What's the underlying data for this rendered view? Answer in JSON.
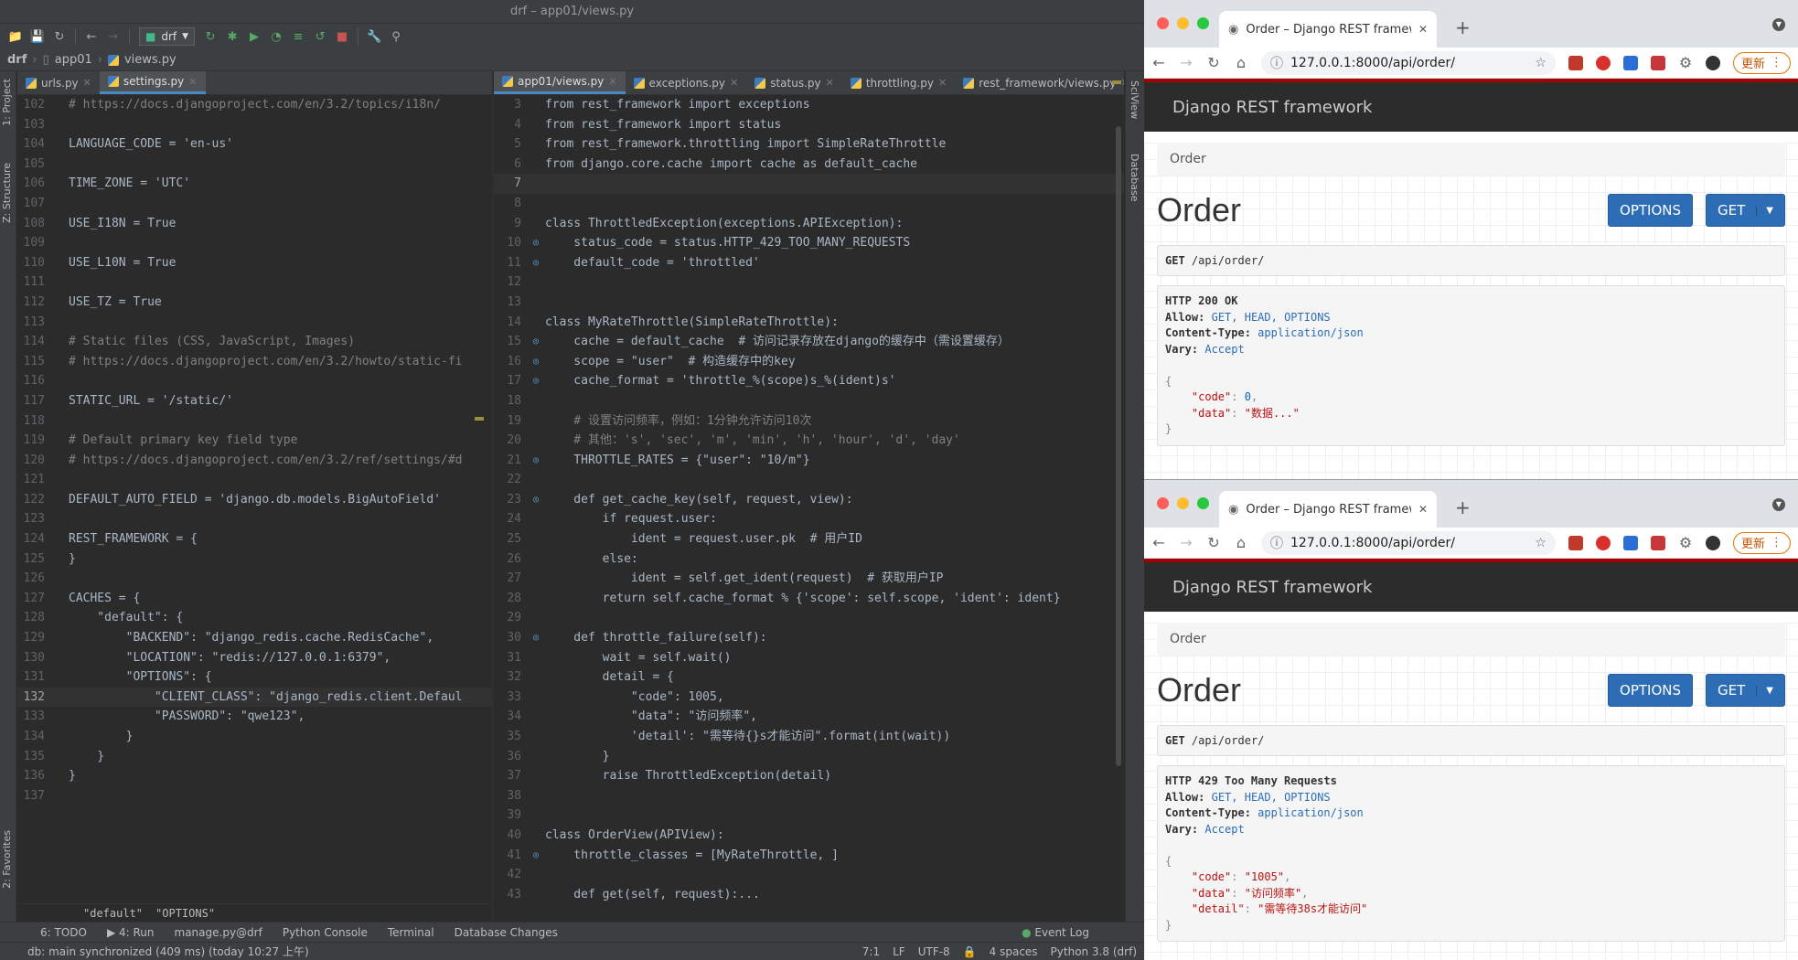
{
  "ide": {
    "window_title": "drf – app01/views.py",
    "run_config": "drf",
    "breadcrumb": [
      "drf",
      "app01",
      "views.py"
    ],
    "left_tool_windows": [
      "1: Project",
      "Z: Structure",
      "2: Favorites"
    ],
    "right_tool_windows": [
      "SciView",
      "Database"
    ],
    "left_tabs": [
      {
        "label": "urls.py",
        "active": false
      },
      {
        "label": "settings.py",
        "active": true
      }
    ],
    "right_tabs": [
      {
        "label": "app01/views.py",
        "active": true
      },
      {
        "label": "exceptions.py",
        "active": false
      },
      {
        "label": "status.py",
        "active": false
      },
      {
        "label": "throttling.py",
        "active": false
      },
      {
        "label": "rest_framework/views.py",
        "active": false
      }
    ],
    "left_code_breadcrumb": [
      "\"default\"",
      "\"OPTIONS\""
    ],
    "bottom_tools": [
      "6: TODO",
      "4: Run",
      "manage.py@drf",
      "Python Console",
      "Terminal",
      "Database Changes",
      "Event Log"
    ],
    "status_message": "db: main synchronized (409 ms) (today 10:27 上午)",
    "status_right": [
      "7:1",
      "LF",
      "UTF-8",
      "4 spaces",
      "Python 3.8 (drf)"
    ]
  },
  "left_code": [
    {
      "n": "102",
      "t": "# https://docs.djangoproject.com/en/3.2/topics/i18n/"
    },
    {
      "n": "103",
      "t": ""
    },
    {
      "n": "104",
      "t": "LANGUAGE_CODE = 'en-us'"
    },
    {
      "n": "105",
      "t": ""
    },
    {
      "n": "106",
      "t": "TIME_ZONE = 'UTC'"
    },
    {
      "n": "107",
      "t": ""
    },
    {
      "n": "108",
      "t": "USE_I18N = True"
    },
    {
      "n": "109",
      "t": ""
    },
    {
      "n": "110",
      "t": "USE_L10N = True"
    },
    {
      "n": "111",
      "t": ""
    },
    {
      "n": "112",
      "t": "USE_TZ = True"
    },
    {
      "n": "113",
      "t": ""
    },
    {
      "n": "114",
      "t": "# Static files (CSS, JavaScript, Images)"
    },
    {
      "n": "115",
      "t": "# https://docs.djangoproject.com/en/3.2/howto/static-fi"
    },
    {
      "n": "116",
      "t": ""
    },
    {
      "n": "117",
      "t": "STATIC_URL = '/static/'"
    },
    {
      "n": "118",
      "t": ""
    },
    {
      "n": "119",
      "t": "# Default primary key field type"
    },
    {
      "n": "120",
      "t": "# https://docs.djangoproject.com/en/3.2/ref/settings/#d"
    },
    {
      "n": "121",
      "t": ""
    },
    {
      "n": "122",
      "t": "DEFAULT_AUTO_FIELD = 'django.db.models.BigAutoField'"
    },
    {
      "n": "123",
      "t": ""
    },
    {
      "n": "124",
      "t": "REST_FRAMEWORK = {"
    },
    {
      "n": "125",
      "t": "}"
    },
    {
      "n": "126",
      "t": ""
    },
    {
      "n": "127",
      "t": "CACHES = {"
    },
    {
      "n": "128",
      "t": "    \"default\": {"
    },
    {
      "n": "129",
      "t": "        \"BACKEND\": \"django_redis.cache.RedisCache\","
    },
    {
      "n": "130",
      "t": "        \"LOCATION\": \"redis://127.0.0.1:6379\","
    },
    {
      "n": "131",
      "t": "        \"OPTIONS\": {"
    },
    {
      "n": "132",
      "t": "            \"CLIENT_CLASS\": \"django_redis.client.Defaul"
    },
    {
      "n": "133",
      "t": "            \"PASSWORD\": \"qwe123\","
    },
    {
      "n": "134",
      "t": "        }"
    },
    {
      "n": "135",
      "t": "    }"
    },
    {
      "n": "136",
      "t": "}"
    },
    {
      "n": "137",
      "t": ""
    }
  ],
  "right_code": [
    {
      "n": "3",
      "t": "from rest_framework import exceptions"
    },
    {
      "n": "4",
      "t": "from rest_framework import status"
    },
    {
      "n": "5",
      "t": "from rest_framework.throttling import SimpleRateThrottle"
    },
    {
      "n": "6",
      "t": "from django.core.cache import cache as default_cache"
    },
    {
      "n": "7",
      "t": ""
    },
    {
      "n": "8",
      "t": ""
    },
    {
      "n": "9",
      "t": "class ThrottledException(exceptions.APIException):"
    },
    {
      "n": "10",
      "t": "    status_code = status.HTTP_429_TOO_MANY_REQUESTS"
    },
    {
      "n": "11",
      "t": "    default_code = 'throttled'"
    },
    {
      "n": "12",
      "t": ""
    },
    {
      "n": "13",
      "t": ""
    },
    {
      "n": "14",
      "t": "class MyRateThrottle(SimpleRateThrottle):"
    },
    {
      "n": "15",
      "t": "    cache = default_cache  # 访问记录存放在django的缓存中（需设置缓存）"
    },
    {
      "n": "16",
      "t": "    scope = \"user\"  # 构造缓存中的key"
    },
    {
      "n": "17",
      "t": "    cache_format = 'throttle_%(scope)s_%(ident)s'"
    },
    {
      "n": "18",
      "t": ""
    },
    {
      "n": "19",
      "t": "    # 设置访问频率，例如：1分钟允许访问10次"
    },
    {
      "n": "20",
      "t": "    # 其他：'s', 'sec', 'm', 'min', 'h', 'hour', 'd', 'day'"
    },
    {
      "n": "21",
      "t": "    THROTTLE_RATES = {\"user\": \"10/m\"}"
    },
    {
      "n": "22",
      "t": ""
    },
    {
      "n": "23",
      "t": "    def get_cache_key(self, request, view):"
    },
    {
      "n": "24",
      "t": "        if request.user:"
    },
    {
      "n": "25",
      "t": "            ident = request.user.pk  # 用户ID"
    },
    {
      "n": "26",
      "t": "        else:"
    },
    {
      "n": "27",
      "t": "            ident = self.get_ident(request)  # 获取用户IP"
    },
    {
      "n": "28",
      "t": "        return self.cache_format % {'scope': self.scope, 'ident': ident}"
    },
    {
      "n": "29",
      "t": ""
    },
    {
      "n": "30",
      "t": "    def throttle_failure(self):"
    },
    {
      "n": "31",
      "t": "        wait = self.wait()"
    },
    {
      "n": "32",
      "t": "        detail = {"
    },
    {
      "n": "33",
      "t": "            \"code\": 1005,"
    },
    {
      "n": "34",
      "t": "            \"data\": \"访问频率\","
    },
    {
      "n": "35",
      "t": "            'detail': \"需等待{}s才能访问\".format(int(wait))"
    },
    {
      "n": "36",
      "t": "        }"
    },
    {
      "n": "37",
      "t": "        raise ThrottledException(detail)"
    },
    {
      "n": "38",
      "t": ""
    },
    {
      "n": "39",
      "t": ""
    },
    {
      "n": "40",
      "t": "class OrderView(APIView):"
    },
    {
      "n": "41",
      "t": "    throttle_classes = [MyRateThrottle, ]"
    },
    {
      "n": "42",
      "t": ""
    },
    {
      "n": "43",
      "t": "    def get(self, request):..."
    }
  ],
  "browser_top": {
    "tab_title": "Order – Django REST framework",
    "url": "127.0.0.1:8000/api/order/",
    "update_label": "更新",
    "navbar_brand": "Django REST framework",
    "breadcrumb": "Order",
    "page_title": "Order",
    "options_label": "OPTIONS",
    "get_label": "GET",
    "request_method": "GET",
    "request_path": "/api/order/",
    "status_line": "HTTP 200 OK",
    "headers": [
      {
        "k": "Allow:",
        "v": "GET, HEAD, OPTIONS"
      },
      {
        "k": "Content-Type:",
        "v": "application/json"
      },
      {
        "k": "Vary:",
        "v": "Accept"
      }
    ],
    "body": [
      {
        "k": "\"code\"",
        "v": "0"
      },
      {
        "k": "\"data\"",
        "v": "\"数据...\""
      }
    ]
  },
  "browser_bottom": {
    "tab_title": "Order – Django REST framework",
    "url": "127.0.0.1:8000/api/order/",
    "update_label": "更新",
    "navbar_brand": "Django REST framework",
    "breadcrumb": "Order",
    "page_title": "Order",
    "options_label": "OPTIONS",
    "get_label": "GET",
    "request_method": "GET",
    "request_path": "/api/order/",
    "status_line": "HTTP 429 Too Many Requests",
    "headers": [
      {
        "k": "Allow:",
        "v": "GET, HEAD, OPTIONS"
      },
      {
        "k": "Content-Type:",
        "v": "application/json"
      },
      {
        "k": "Vary:",
        "v": "Accept"
      }
    ],
    "body": [
      {
        "k": "\"code\"",
        "v": "\"1005\""
      },
      {
        "k": "\"data\"",
        "v": "\"访问频率\""
      },
      {
        "k": "\"detail\"",
        "v": "\"需等待38s才能访问\""
      }
    ]
  }
}
